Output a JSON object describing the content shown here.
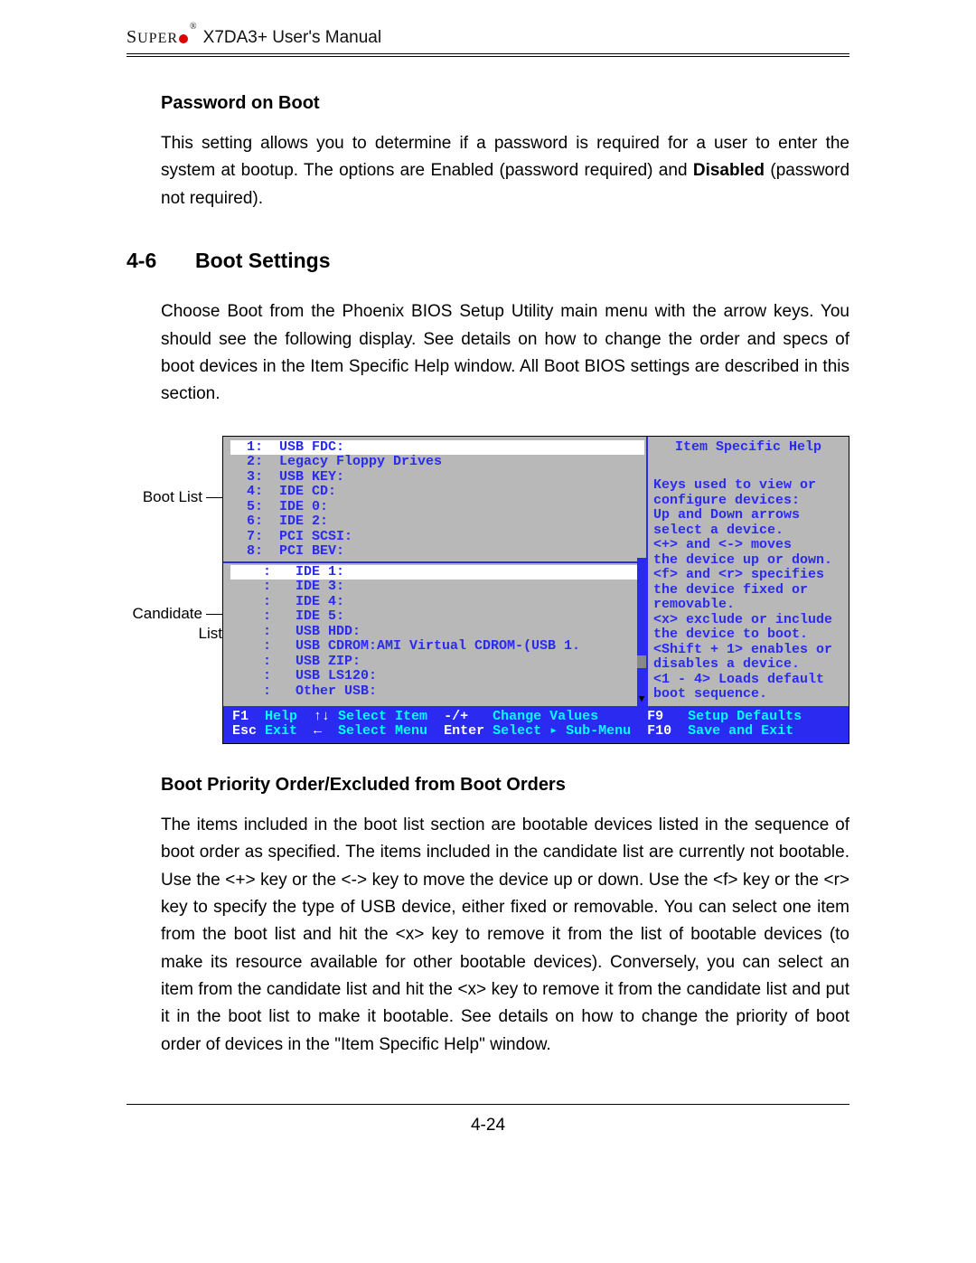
{
  "header": {
    "brand_leading": "S",
    "brand_rest": "UPER",
    "manual": "X7DA3+ User's Manual"
  },
  "pwd": {
    "heading": "Password on Boot",
    "para": "This setting allows you to determine if  a password is required for a user to enter the system at bootup.  The options are Enabled (password required) and ",
    "bold": "Disabled",
    "tail": " (password not required)."
  },
  "section": {
    "num": "4-6",
    "title": "Boot Settings",
    "intro": "Choose Boot from the Phoenix BIOS Setup Utility main menu with the arrow keys. You should see the following display.  See details on how to change the order and specs of boot devices in the Item Specific Help window.  All Boot BIOS settings are described in this section."
  },
  "labels": {
    "bootlist": "Boot List",
    "candidate1": "Candidate",
    "candidate2": "List"
  },
  "bios": {
    "help_title": "Item Specific Help",
    "boot": [
      {
        "n": "1:",
        "t": "USB FDC:"
      },
      {
        "n": "2:",
        "t": "Legacy Floppy Drives"
      },
      {
        "n": "3:",
        "t": "USB KEY:"
      },
      {
        "n": "4:",
        "t": "IDE CD:"
      },
      {
        "n": "5:",
        "t": "IDE 0:"
      },
      {
        "n": "6:",
        "t": "IDE 2:"
      },
      {
        "n": "7:",
        "t": "PCI SCSI:"
      },
      {
        "n": "8:",
        "t": "PCI BEV:"
      }
    ],
    "candidate": [
      {
        "n": ":",
        "t": "IDE 1:"
      },
      {
        "n": ":",
        "t": "IDE 3:"
      },
      {
        "n": ":",
        "t": "IDE 4:"
      },
      {
        "n": ":",
        "t": "IDE 5:"
      },
      {
        "n": ":",
        "t": "USB HDD:"
      },
      {
        "n": ":",
        "t": "USB CDROM:AMI Virtual CDROM-(USB 1."
      },
      {
        "n": ":",
        "t": "USB ZIP:"
      },
      {
        "n": ":",
        "t": "USB LS120:"
      },
      {
        "n": ":",
        "t": "Other USB:"
      }
    ],
    "help_lines": [
      "Keys used to view or",
      "configure devices:",
      "Up and Down arrows",
      "select a device.",
      "<+> and <-> moves",
      "the device up or down.",
      "<f> and <r> specifies",
      "the device fixed or",
      "removable.",
      "<x> exclude or include",
      "the device to boot.",
      "<Shift + 1> enables or",
      "disables a device.",
      "<1 - 4> Loads default",
      "boot sequence."
    ],
    "footer1": {
      "k1": "F1",
      "a1": "Help",
      "k2": "↑↓",
      "a2": "Select Item",
      "k3": "-/+",
      "a3": "Change Values",
      "k4": "F9",
      "a4": "Setup Defaults"
    },
    "footer2": {
      "k1": "Esc",
      "a1": "Exit",
      "k2": "←",
      "a2": "Select Menu",
      "k3": "Enter",
      "a3": "Select ▸ Sub-Menu",
      "k4": "F10",
      "a4": "Save and Exit"
    }
  },
  "boot_order": {
    "heading": "Boot Priority Order/Excluded from Boot Orders",
    "para": "The items included in the boot list section are bootable devices listed in the sequence of boot order as specified. The items included in the candidate list are currently not bootable.  Use the <+> key or the <-> key to move the device up or down. Use the <f> key or the <r> key to specify the type of USB device, either fixed or removable. You can select one item from the boot list and hit the <x> key to remove it from the list of bootable devices (to make its resource available for other bootable devices). Conversely, you can select an item from the candidate list and hit the <x> key  to remove it from the candidate list and put it in the boot list to make it bootable. See details on how to change the priority of boot order of devices in the \"Item Specific Help\" window."
  },
  "pagenum": "4-24"
}
